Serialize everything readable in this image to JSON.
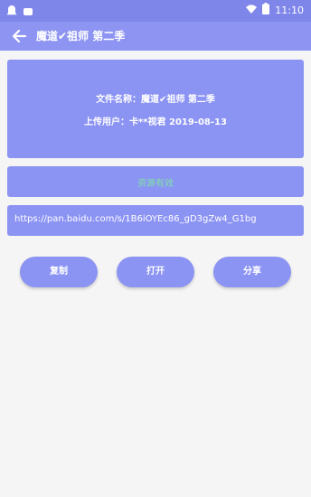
{
  "status_bar": {
    "time": "11:10"
  },
  "app_bar": {
    "title": "魔道✔祖师 第二季",
    "icons": {
      "back": "arrow-left-icon"
    }
  },
  "info": {
    "file_line": "文件名称：魔道✔祖师 第二季",
    "uploader_line": "上传用户：卡**视君 2019-08-13"
  },
  "status": {
    "text": "资源有效"
  },
  "link": {
    "url": "https://pan.baidu.com/s/1B6iOYEc86_gD3gZw4_G1bg"
  },
  "actions": {
    "copy": "复制",
    "open": "打开",
    "share": "分享"
  },
  "colors": {
    "status_bar": "#7f86ea",
    "app_bar": "#8d94f1",
    "card": "#8b93f3",
    "status_text": "#7fe3a6",
    "background": "#f5f5f5"
  }
}
